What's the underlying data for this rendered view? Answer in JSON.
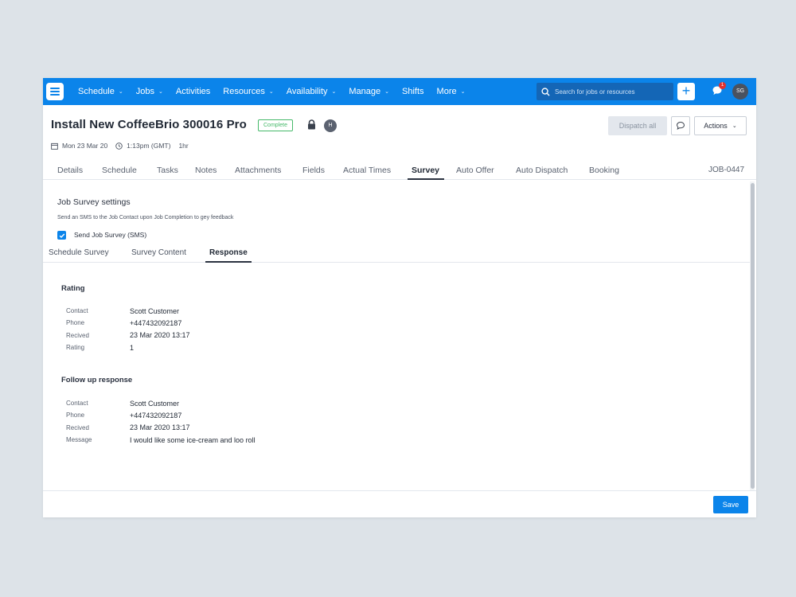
{
  "nav": {
    "items": [
      {
        "label": "Schedule",
        "dropdown": true
      },
      {
        "label": "Jobs",
        "dropdown": true
      },
      {
        "label": "Activities",
        "dropdown": false
      },
      {
        "label": "Resources",
        "dropdown": true
      },
      {
        "label": "Availability",
        "dropdown": true
      },
      {
        "label": "Manage",
        "dropdown": true
      },
      {
        "label": "Shifts",
        "dropdown": false
      },
      {
        "label": "More",
        "dropdown": true
      }
    ],
    "search_placeholder": "Search for jobs or resources",
    "add_label": "+",
    "notification_count": "1",
    "user_initials": "SG"
  },
  "job": {
    "title": "Install New CoffeeBrio 300016 Pro",
    "status": "Complete",
    "assignee_initial": "H",
    "date": "Mon 23 Mar 20",
    "time": "1:13pm (GMT)",
    "duration": "1hr",
    "id": "JOB-0447"
  },
  "header_actions": {
    "dispatch_label": "Dispatch all",
    "actions_label": "Actions"
  },
  "tabs": {
    "details": "Details",
    "schedule": "Schedule",
    "tasks": "Tasks",
    "notes": "Notes",
    "attachments": "Attachments",
    "fields": "Fields",
    "actual_times": "Actual Times",
    "survey": "Survey",
    "auto_offer": "Auto Offer",
    "auto_dispatch": "Auto Dispatch",
    "booking": "Booking",
    "active": "Survey"
  },
  "survey_settings": {
    "title": "Job Survey settings",
    "description": "Send an SMS to the Job Contact upon Job Completion to gey feedback",
    "send_sms_label": "Send Job Survey (SMS)",
    "send_sms_checked": true
  },
  "subtabs": {
    "schedule_survey": "Schedule Survey",
    "survey_content": "Survey Content",
    "response": "Response",
    "active": "Response"
  },
  "rating": {
    "title": "Rating",
    "contact_label": "Contact",
    "contact": "Scott Customer",
    "phone_label": "Phone",
    "phone": "+447432092187",
    "received_label": "Recived",
    "received": "23 Mar 2020 13:17",
    "rating_label": "Rating",
    "rating": "1"
  },
  "follow_up": {
    "title": "Follow up response",
    "contact_label": "Contact",
    "contact": "Scott Customer",
    "phone_label": "Phone",
    "phone": "+447432092187",
    "received_label": "Recived",
    "received": "23 Mar 2020 13:17",
    "message_label": "Message",
    "message": "I would like some ice-cream and loo roll"
  },
  "footer": {
    "save_label": "Save"
  },
  "colors": {
    "brand": "#0b84ea",
    "status_complete": "#46b96a",
    "notification": "#e0312f"
  }
}
